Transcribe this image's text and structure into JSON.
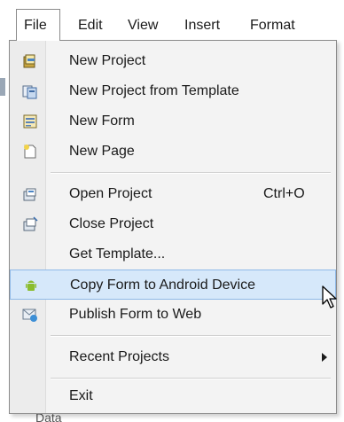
{
  "menubar": {
    "items": [
      {
        "label": "File"
      },
      {
        "label": "Edit"
      },
      {
        "label": "View"
      },
      {
        "label": "Insert"
      },
      {
        "label": "Format"
      }
    ]
  },
  "file_menu": {
    "items": [
      {
        "label": "New Project",
        "icon": "new-project-icon"
      },
      {
        "label": "New Project from Template",
        "icon": "template-icon"
      },
      {
        "label": "New Form",
        "icon": "new-form-icon"
      },
      {
        "label": "New Page",
        "icon": "new-page-icon"
      },
      {
        "label": "Open Project",
        "shortcut": "Ctrl+O",
        "icon": "open-project-icon"
      },
      {
        "label": "Close Project",
        "icon": "close-project-icon"
      },
      {
        "label": "Get Template..."
      },
      {
        "label": "Copy Form to Android Device",
        "icon": "android-icon",
        "highlighted": true
      },
      {
        "label": "Publish Form to Web",
        "icon": "publish-web-icon"
      },
      {
        "label": "Recent Projects",
        "has_submenu": true
      },
      {
        "label": "Exit"
      }
    ]
  },
  "underlying": {
    "partial_text": "Data"
  },
  "colors": {
    "highlight_bg": "#d6e8fa",
    "highlight_border": "#8fb9e8",
    "menu_bg": "#f3f3f3"
  }
}
